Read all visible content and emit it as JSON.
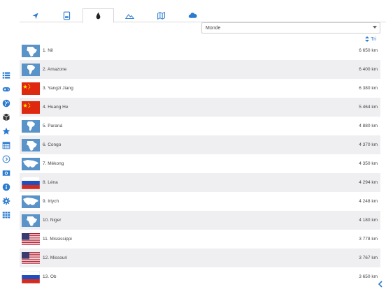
{
  "tabs": [
    {
      "icon": "pin-icon",
      "active": false
    },
    {
      "icon": "book-icon",
      "active": false
    },
    {
      "icon": "drop-icon",
      "active": true
    },
    {
      "icon": "mountain-icon",
      "active": false
    },
    {
      "icon": "map-icon",
      "active": false
    },
    {
      "icon": "cloud-icon",
      "active": false
    }
  ],
  "region_select": {
    "value": "Monde"
  },
  "sort": {
    "label": "Tri"
  },
  "sidebar": [
    "list-icon",
    "gamepad-icon",
    "globe-icon",
    "cube-icon",
    "star-icon",
    "calendar-icon",
    "chevron-circle-icon",
    "photo-icon",
    "info-icon",
    "gear-icon",
    "grid-icon"
  ],
  "colors": {
    "accent": "#2b7bd0",
    "row_alt": "#efeff1",
    "continent_bg": "#5a93c8"
  },
  "rivers": [
    {
      "name": "1. Nil",
      "length": "6 650 km",
      "thumb": "africa"
    },
    {
      "name": "2. Amazone",
      "length": "6 400 km",
      "thumb": "south-america"
    },
    {
      "name": "3. Yangzi Jiang",
      "length": "6 380 km",
      "thumb": "china"
    },
    {
      "name": "4. Huang He",
      "length": "5 464 km",
      "thumb": "china"
    },
    {
      "name": "5. Paraná",
      "length": "4 880 km",
      "thumb": "south-america"
    },
    {
      "name": "6. Congo",
      "length": "4 370 km",
      "thumb": "africa"
    },
    {
      "name": "7. Mékong",
      "length": "4 350 km",
      "thumb": "asia"
    },
    {
      "name": "8. Léna",
      "length": "4 294 km",
      "thumb": "russia"
    },
    {
      "name": "9. Irtych",
      "length": "4 248 km",
      "thumb": "asia"
    },
    {
      "name": "10. Niger",
      "length": "4 180 km",
      "thumb": "africa"
    },
    {
      "name": "11. Mississippi",
      "length": "3 778 km",
      "thumb": "usa"
    },
    {
      "name": "12. Missouri",
      "length": "3 767 km",
      "thumb": "usa"
    },
    {
      "name": "13. Ob",
      "length": "3 650 km",
      "thumb": "russia"
    }
  ]
}
